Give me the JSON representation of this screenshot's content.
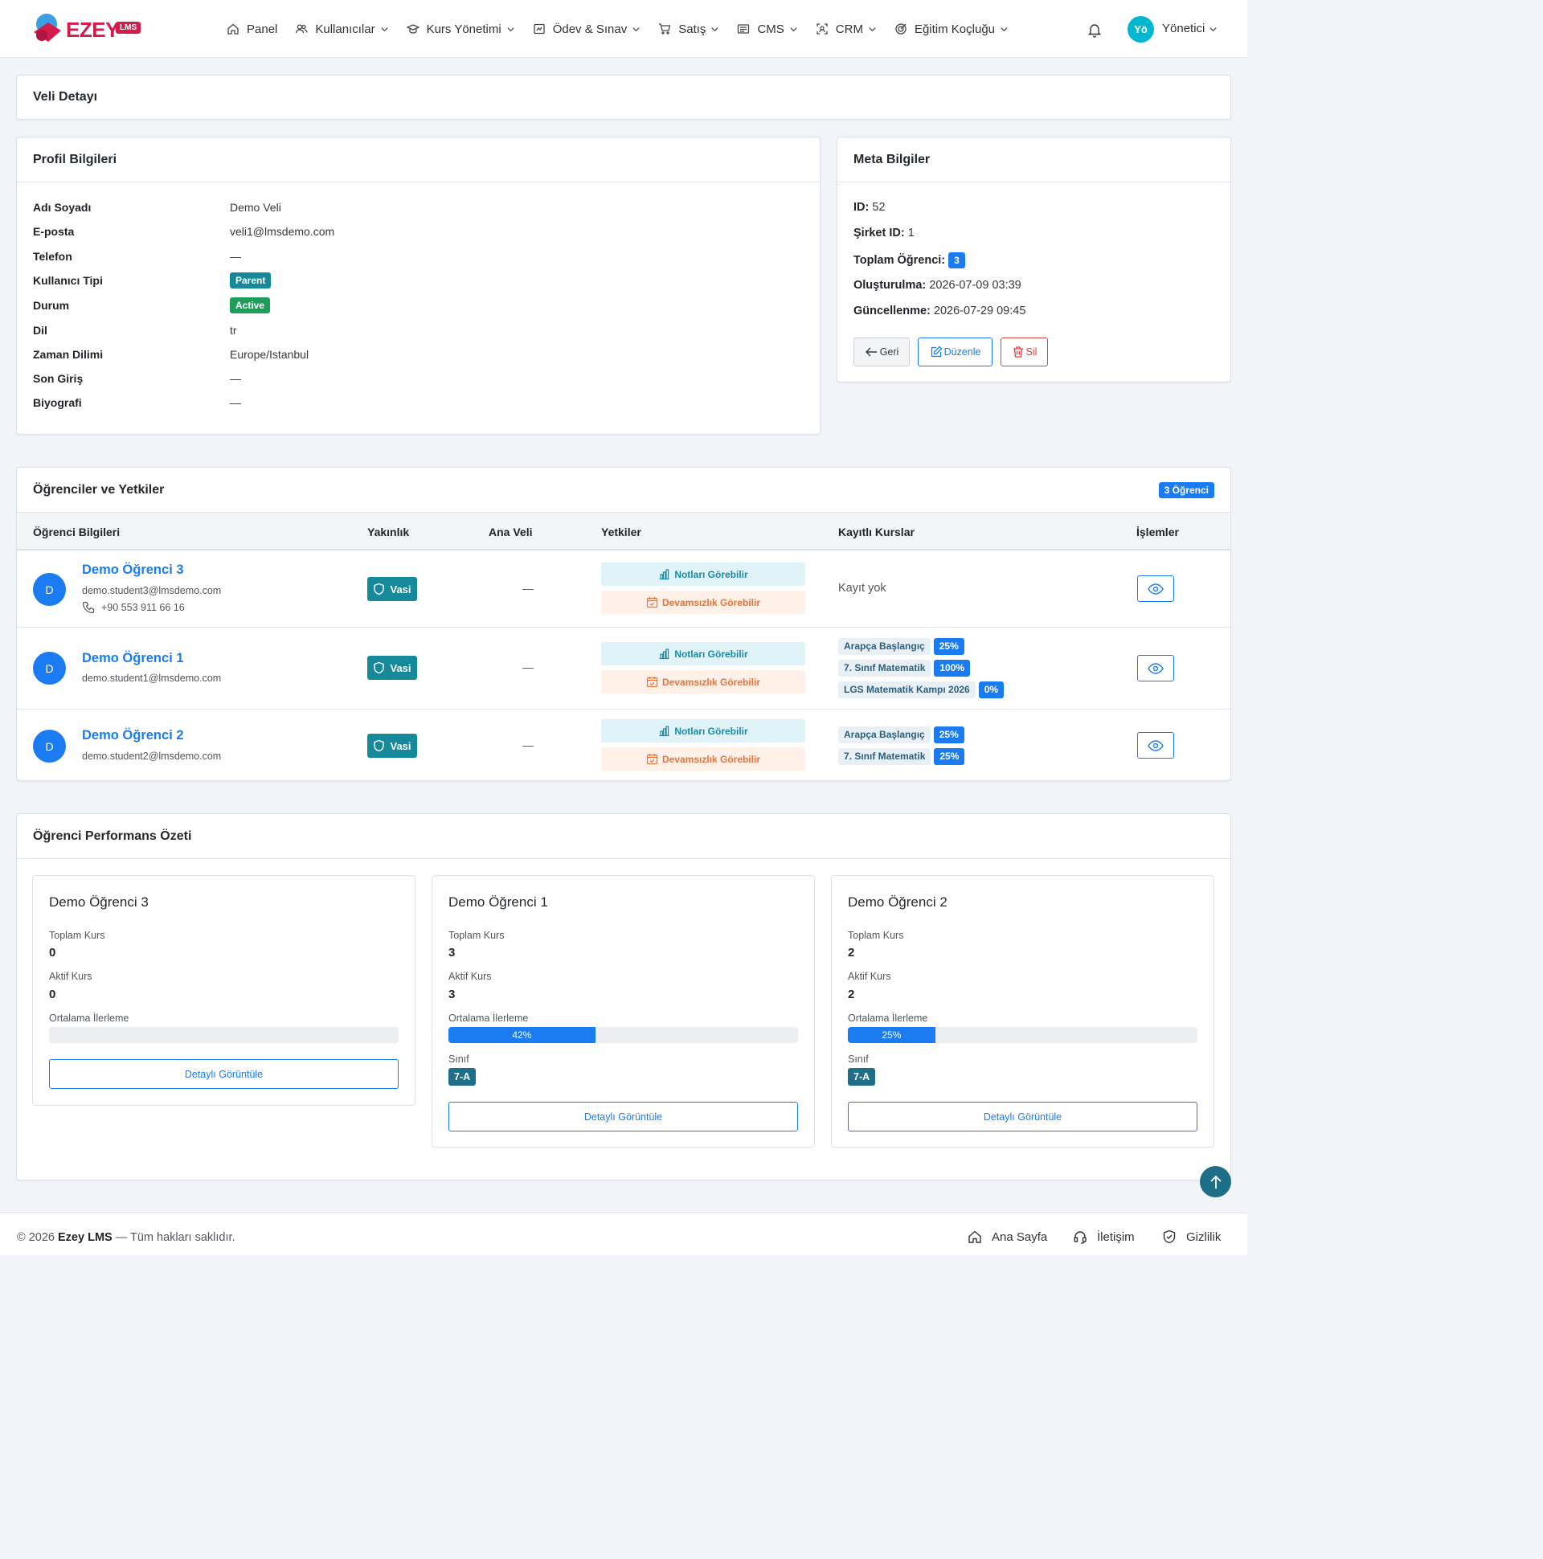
{
  "brand": {
    "logo_text": "EZEY",
    "logo_badge": "LMS"
  },
  "nav": {
    "items": [
      {
        "label": "Panel",
        "icon": "home-icon"
      },
      {
        "label": "Kullanıcılar",
        "icon": "users-icon"
      },
      {
        "label": "Kurs Yönetimi",
        "icon": "graduation-cap-icon"
      },
      {
        "label": "Ödev & Sınav",
        "icon": "clipboard-icon"
      },
      {
        "label": "Satış",
        "icon": "cart-icon"
      },
      {
        "label": "CMS",
        "icon": "cms-icon"
      },
      {
        "label": "CRM",
        "icon": "crm-icon"
      },
      {
        "label": "Eğitim Koçluğu",
        "icon": "target-icon"
      }
    ],
    "user_initials": "Yö",
    "user_name": "Yönetici"
  },
  "page_title": "Veli Detayı",
  "profile": {
    "title": "Profil Bilgileri",
    "fields": [
      {
        "label": "Adı Soyadı",
        "value": "Demo Veli"
      },
      {
        "label": "E-posta",
        "value": "veli1@lmsdemo.com"
      },
      {
        "label": "Telefon",
        "value": "—"
      },
      {
        "label": "Kullanıcı Tipi",
        "value": "Parent"
      },
      {
        "label": "Durum",
        "value": "Active"
      },
      {
        "label": "Dil",
        "value": "tr"
      },
      {
        "label": "Zaman Dilimi",
        "value": "Europe/Istanbul"
      },
      {
        "label": "Son Giriş",
        "value": "—"
      },
      {
        "label": "Biyografi",
        "value": "—"
      }
    ]
  },
  "meta": {
    "title": "Meta Bilgiler",
    "id_label": "ID:",
    "id_value": "52",
    "company_label": "Şirket ID:",
    "company_value": "1",
    "total_label": "Toplam Öğrenci:",
    "total_value": "3",
    "created_label": "Oluşturulma:",
    "created_value": "2026-07-09 03:39",
    "updated_label": "Güncellenme:",
    "updated_value": "2026-07-29 09:45",
    "back_label": "Geri",
    "edit_label": "Düzenle",
    "delete_label": "Sil"
  },
  "students_section": {
    "title": "Öğrenciler ve Yetkiler",
    "count_badge": "3 Öğrenci",
    "columns": [
      "Öğrenci Bilgileri",
      "Yakınlık",
      "Ana Veli",
      "Yetkiler",
      "Kayıtlı Kurslar",
      "İşlemler"
    ],
    "rows": [
      {
        "initial": "D",
        "name": "Demo Öğrenci 3",
        "email": "demo.student3@lmsdemo.com",
        "phone": "+90 553 911 66 16",
        "relation": "Vasi",
        "primary": "—",
        "perm_notes": "Notları Görebilir",
        "perm_attendance": "Devamsızlık Görebilir",
        "no_courses": "Kayıt yok",
        "courses": []
      },
      {
        "initial": "D",
        "name": "Demo Öğrenci 1",
        "email": "demo.student1@lmsdemo.com",
        "phone": "",
        "relation": "Vasi",
        "primary": "—",
        "perm_notes": "Notları Görebilir",
        "perm_attendance": "Devamsızlık Görebilir",
        "no_courses": "",
        "courses": [
          {
            "name": "Arapça Başlangıç",
            "pct": "25%"
          },
          {
            "name": "7. Sınıf Matematik",
            "pct": "100%"
          },
          {
            "name": "LGS Matematik Kampı 2026",
            "pct": "0%"
          }
        ]
      },
      {
        "initial": "D",
        "name": "Demo Öğrenci 2",
        "email": "demo.student2@lmsdemo.com",
        "phone": "",
        "relation": "Vasi",
        "primary": "—",
        "perm_notes": "Notları Görebilir",
        "perm_attendance": "Devamsızlık Görebilir",
        "no_courses": "",
        "courses": [
          {
            "name": "Arapça Başlangıç",
            "pct": "25%"
          },
          {
            "name": "7. Sınıf Matematik",
            "pct": "25%"
          }
        ]
      }
    ]
  },
  "performance": {
    "title": "Öğrenci Performans Özeti",
    "total_label": "Toplam Kurs",
    "active_label": "Aktif Kurs",
    "progress_label": "Ortalama İlerleme",
    "class_label": "Sınıf",
    "detail_label": "Detaylı Görüntüle",
    "cards": [
      {
        "name": "Demo Öğrenci 3",
        "total": "0",
        "active": "0",
        "progress": 0,
        "progress_text": "",
        "class": ""
      },
      {
        "name": "Demo Öğrenci 1",
        "total": "3",
        "active": "3",
        "progress": 42,
        "progress_text": "42%",
        "class": "7-A"
      },
      {
        "name": "Demo Öğrenci 2",
        "total": "2",
        "active": "2",
        "progress": 25,
        "progress_text": "25%",
        "class": "7-A"
      }
    ]
  },
  "footer": {
    "year_text": "© 2026",
    "brand": "Ezey LMS",
    "rights": "— Tüm hakları saklıdır.",
    "links": [
      "Ana Sayfa",
      "İletişim",
      "Gizlilik"
    ]
  },
  "colors": {
    "primary": "#1a7cf0",
    "teal": "#16899b",
    "success": "#1e9e5a",
    "danger": "#e04040",
    "brand": "#d31b4c"
  }
}
